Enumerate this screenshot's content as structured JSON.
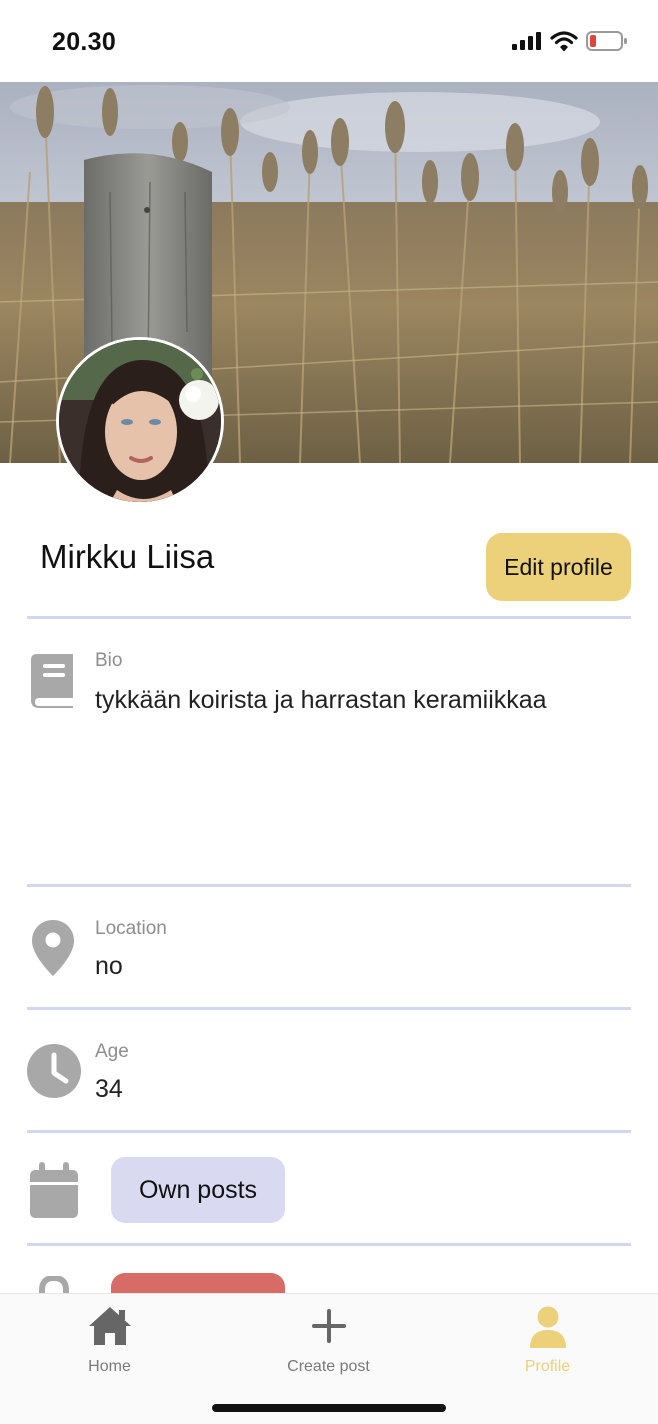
{
  "status_bar": {
    "time": "20.30",
    "icons": [
      "cellular-signal-icon",
      "wifi-icon",
      "battery-low-icon"
    ],
    "battery_color": "#e0443a"
  },
  "profile": {
    "name": "Mirkku Liisa",
    "edit_label": "Edit profile",
    "cover_image": "reed-field-with-wooden-post-photo",
    "avatar_image": "woman-with-white-flower-photo"
  },
  "fields": {
    "bio": {
      "label": "Bio",
      "value": "tykkään koirista ja harrastan keramiikkaa",
      "icon": "book-icon"
    },
    "location": {
      "label": "Location",
      "value": "no",
      "icon": "map-pin-icon"
    },
    "age": {
      "label": "Age",
      "value": "34",
      "icon": "clock-icon"
    }
  },
  "actions": {
    "own_posts_label": "Own posts",
    "own_posts_icon": "calendar-icon",
    "partial_button_icon": "lock-icon"
  },
  "bottom_nav": {
    "items": [
      {
        "label": "Home",
        "icon": "home-icon",
        "active": false
      },
      {
        "label": "Create post",
        "icon": "plus-icon",
        "active": false
      },
      {
        "label": "Profile",
        "icon": "user-icon",
        "active": true
      }
    ]
  },
  "colors": {
    "accent": "#ecd07a",
    "pill": "#d9daf2",
    "danger": "#d76b66",
    "divider": "#d3d6f0",
    "icon_gray": "#a8a8a8"
  }
}
